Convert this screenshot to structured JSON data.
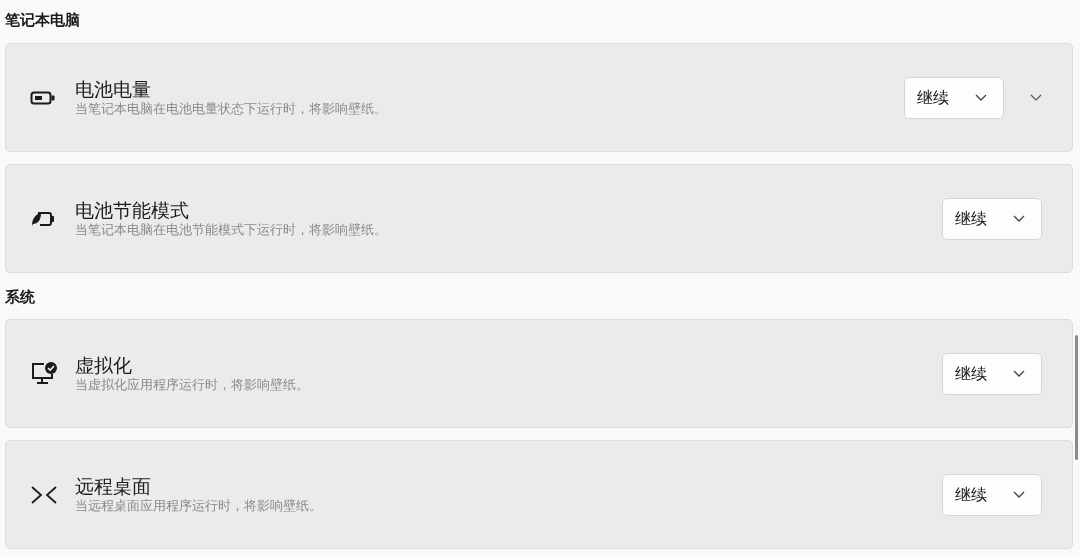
{
  "sections": [
    {
      "title": "笔记本电脑",
      "items": [
        {
          "kind": "battery",
          "title": "电池电量",
          "description": "当笔记本电脑在电池电量状态下运行时，将影响壁纸。",
          "value": "继续",
          "expandable": true
        },
        {
          "kind": "saver",
          "title": "电池节能模式",
          "description": "当笔记本电脑在电池节能模式下运行时，将影响壁纸。",
          "value": "继续",
          "expandable": false
        }
      ]
    },
    {
      "title": "系统",
      "items": [
        {
          "kind": "virtual",
          "title": "虚拟化",
          "description": "当虚拟化应用程序运行时，将影响壁纸。",
          "value": "继续",
          "expandable": false
        },
        {
          "kind": "remote",
          "title": "远程桌面",
          "description": "当远程桌面应用程序运行时，将影响壁纸。",
          "value": "继续",
          "expandable": false
        }
      ]
    }
  ]
}
